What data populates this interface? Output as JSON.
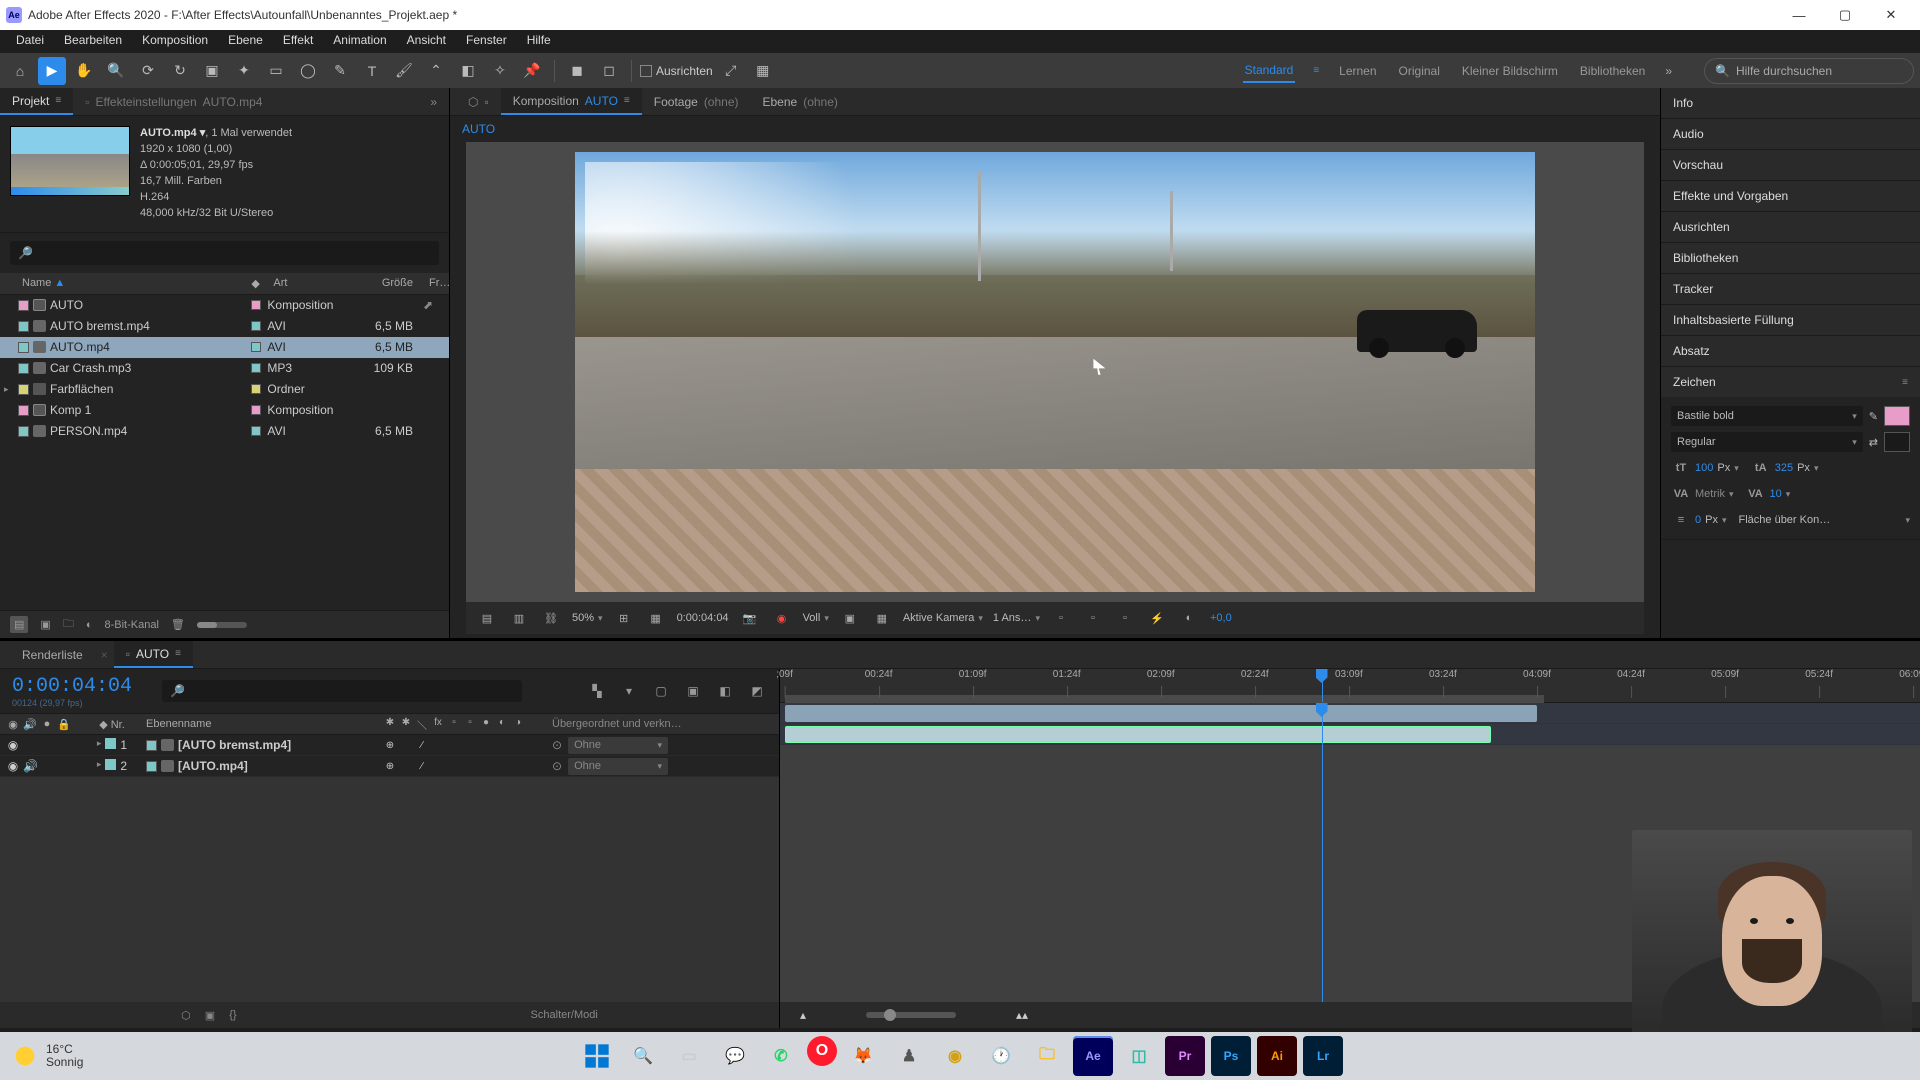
{
  "title": "Adobe After Effects 2020 - F:\\After Effects\\Autounfall\\Unbenanntes_Projekt.aep *",
  "menu": [
    "Datei",
    "Bearbeiten",
    "Komposition",
    "Ebene",
    "Effekt",
    "Animation",
    "Ansicht",
    "Fenster",
    "Hilfe"
  ],
  "workspaces": [
    "Standard",
    "Lernen",
    "Original",
    "Kleiner Bildschirm",
    "Bibliotheken"
  ],
  "active_workspace": "Standard",
  "snap_label": "Ausrichten",
  "search_help_placeholder": "Hilfe durchsuchen",
  "left_tabs": {
    "project": "Projekt",
    "effectcontrols_label": "Effekteinstellungen",
    "effectcontrols_value": "AUTO.mp4"
  },
  "proj_meta": {
    "name": "AUTO.mp4",
    "name_suffix": ", 1 Mal verwendet",
    "res": "1920 x 1080 (1,00)",
    "dur": "Δ 0:00:05;01, 29,97 fps",
    "col": "16,7 Mill. Farben",
    "codec": "H.264",
    "audio": "48,000 kHz/32 Bit U/Stereo"
  },
  "proj_cols": {
    "name": "Name",
    "type": "Art",
    "size": "Größe",
    "rate": "Fr…"
  },
  "proj_items": [
    {
      "name": "AUTO",
      "type": "Komposition",
      "size": "",
      "color": "pink",
      "icon": "comp",
      "flow": true
    },
    {
      "name": "AUTO bremst.mp4",
      "type": "AVI",
      "size": "6,5 MB",
      "color": "teal",
      "icon": "pic"
    },
    {
      "name": "AUTO.mp4",
      "type": "AVI",
      "size": "6,5 MB",
      "color": "teal",
      "icon": "pic",
      "sel": true
    },
    {
      "name": "Car Crash.mp3",
      "type": "MP3",
      "size": "109 KB",
      "color": "teal",
      "icon": "pic"
    },
    {
      "name": "Farbflächen",
      "type": "Ordner",
      "size": "",
      "color": "yellow",
      "icon": "folder",
      "folder": true
    },
    {
      "name": "Komp 1",
      "type": "Komposition",
      "size": "",
      "color": "pink",
      "icon": "comp"
    },
    {
      "name": "PERSON.mp4",
      "type": "AVI",
      "size": "6,5 MB",
      "color": "teal",
      "icon": "pic"
    }
  ],
  "proj_footer": {
    "bpc": "8-Bit-Kanal"
  },
  "comp_tabs": {
    "comp_label": "Komposition",
    "comp_value": "AUTO",
    "footage_label": "Footage",
    "footage_value": "(ohne)",
    "layer_label": "Ebene",
    "layer_value": "(ohne)"
  },
  "crumb": "AUTO",
  "viewer_ctrl": {
    "mag": "50%",
    "time": "0:00:04:04",
    "res": "Voll",
    "camera": "Aktive Kamera",
    "views": "1 Ans…",
    "exposure": "+0,0"
  },
  "side_panels": [
    "Info",
    "Audio",
    "Vorschau",
    "Effekte und Vorgaben",
    "Ausrichten",
    "Bibliotheken",
    "Tracker",
    "Inhaltsbasierte Füllung",
    "Absatz"
  ],
  "char": {
    "title": "Zeichen",
    "font": "Bastile bold",
    "style": "Regular",
    "size_val": "100",
    "size_unit": "Px",
    "leading_val": "325",
    "leading_unit": "Px",
    "kerning": "Metrik",
    "tracking": "10",
    "indent": "0",
    "indent_unit": "Px",
    "fill_label": "Fläche über Kon…"
  },
  "timeline_tabs": {
    "render": "Renderliste",
    "comp": "AUTO"
  },
  "tl_header": {
    "timecode": "0:00:04:04",
    "sub": "00124 (29,97 fps)"
  },
  "tl_cols": {
    "nr": "Nr.",
    "name": "Ebenenname",
    "parent": "Übergeordnet und verkn…"
  },
  "tl_layers": [
    {
      "nr": "1",
      "name": "[AUTO bremst.mp4]",
      "parent": "Ohne"
    },
    {
      "nr": "2",
      "name": "[AUTO.mp4]",
      "parent": "Ohne"
    }
  ],
  "tl_footer": "Schalter/Modi",
  "ruler": [
    ";09f",
    "00:24f",
    "01:09f",
    "01:24f",
    "02:09f",
    "02:24f",
    "03:09f",
    "03:24f",
    "04:09f",
    "04:24f",
    "05:09f",
    "05:24f",
    "06:09f"
  ],
  "weather": {
    "temp": "16°C",
    "desc": "Sonnig"
  },
  "taskbar_apps": [
    "win",
    "search",
    "tasks",
    "chat",
    "whatsapp",
    "opera",
    "firefox",
    "misc1",
    "misc2",
    "clock",
    "files",
    "ae",
    "misc3",
    "pr",
    "ps",
    "ai",
    "lr"
  ]
}
